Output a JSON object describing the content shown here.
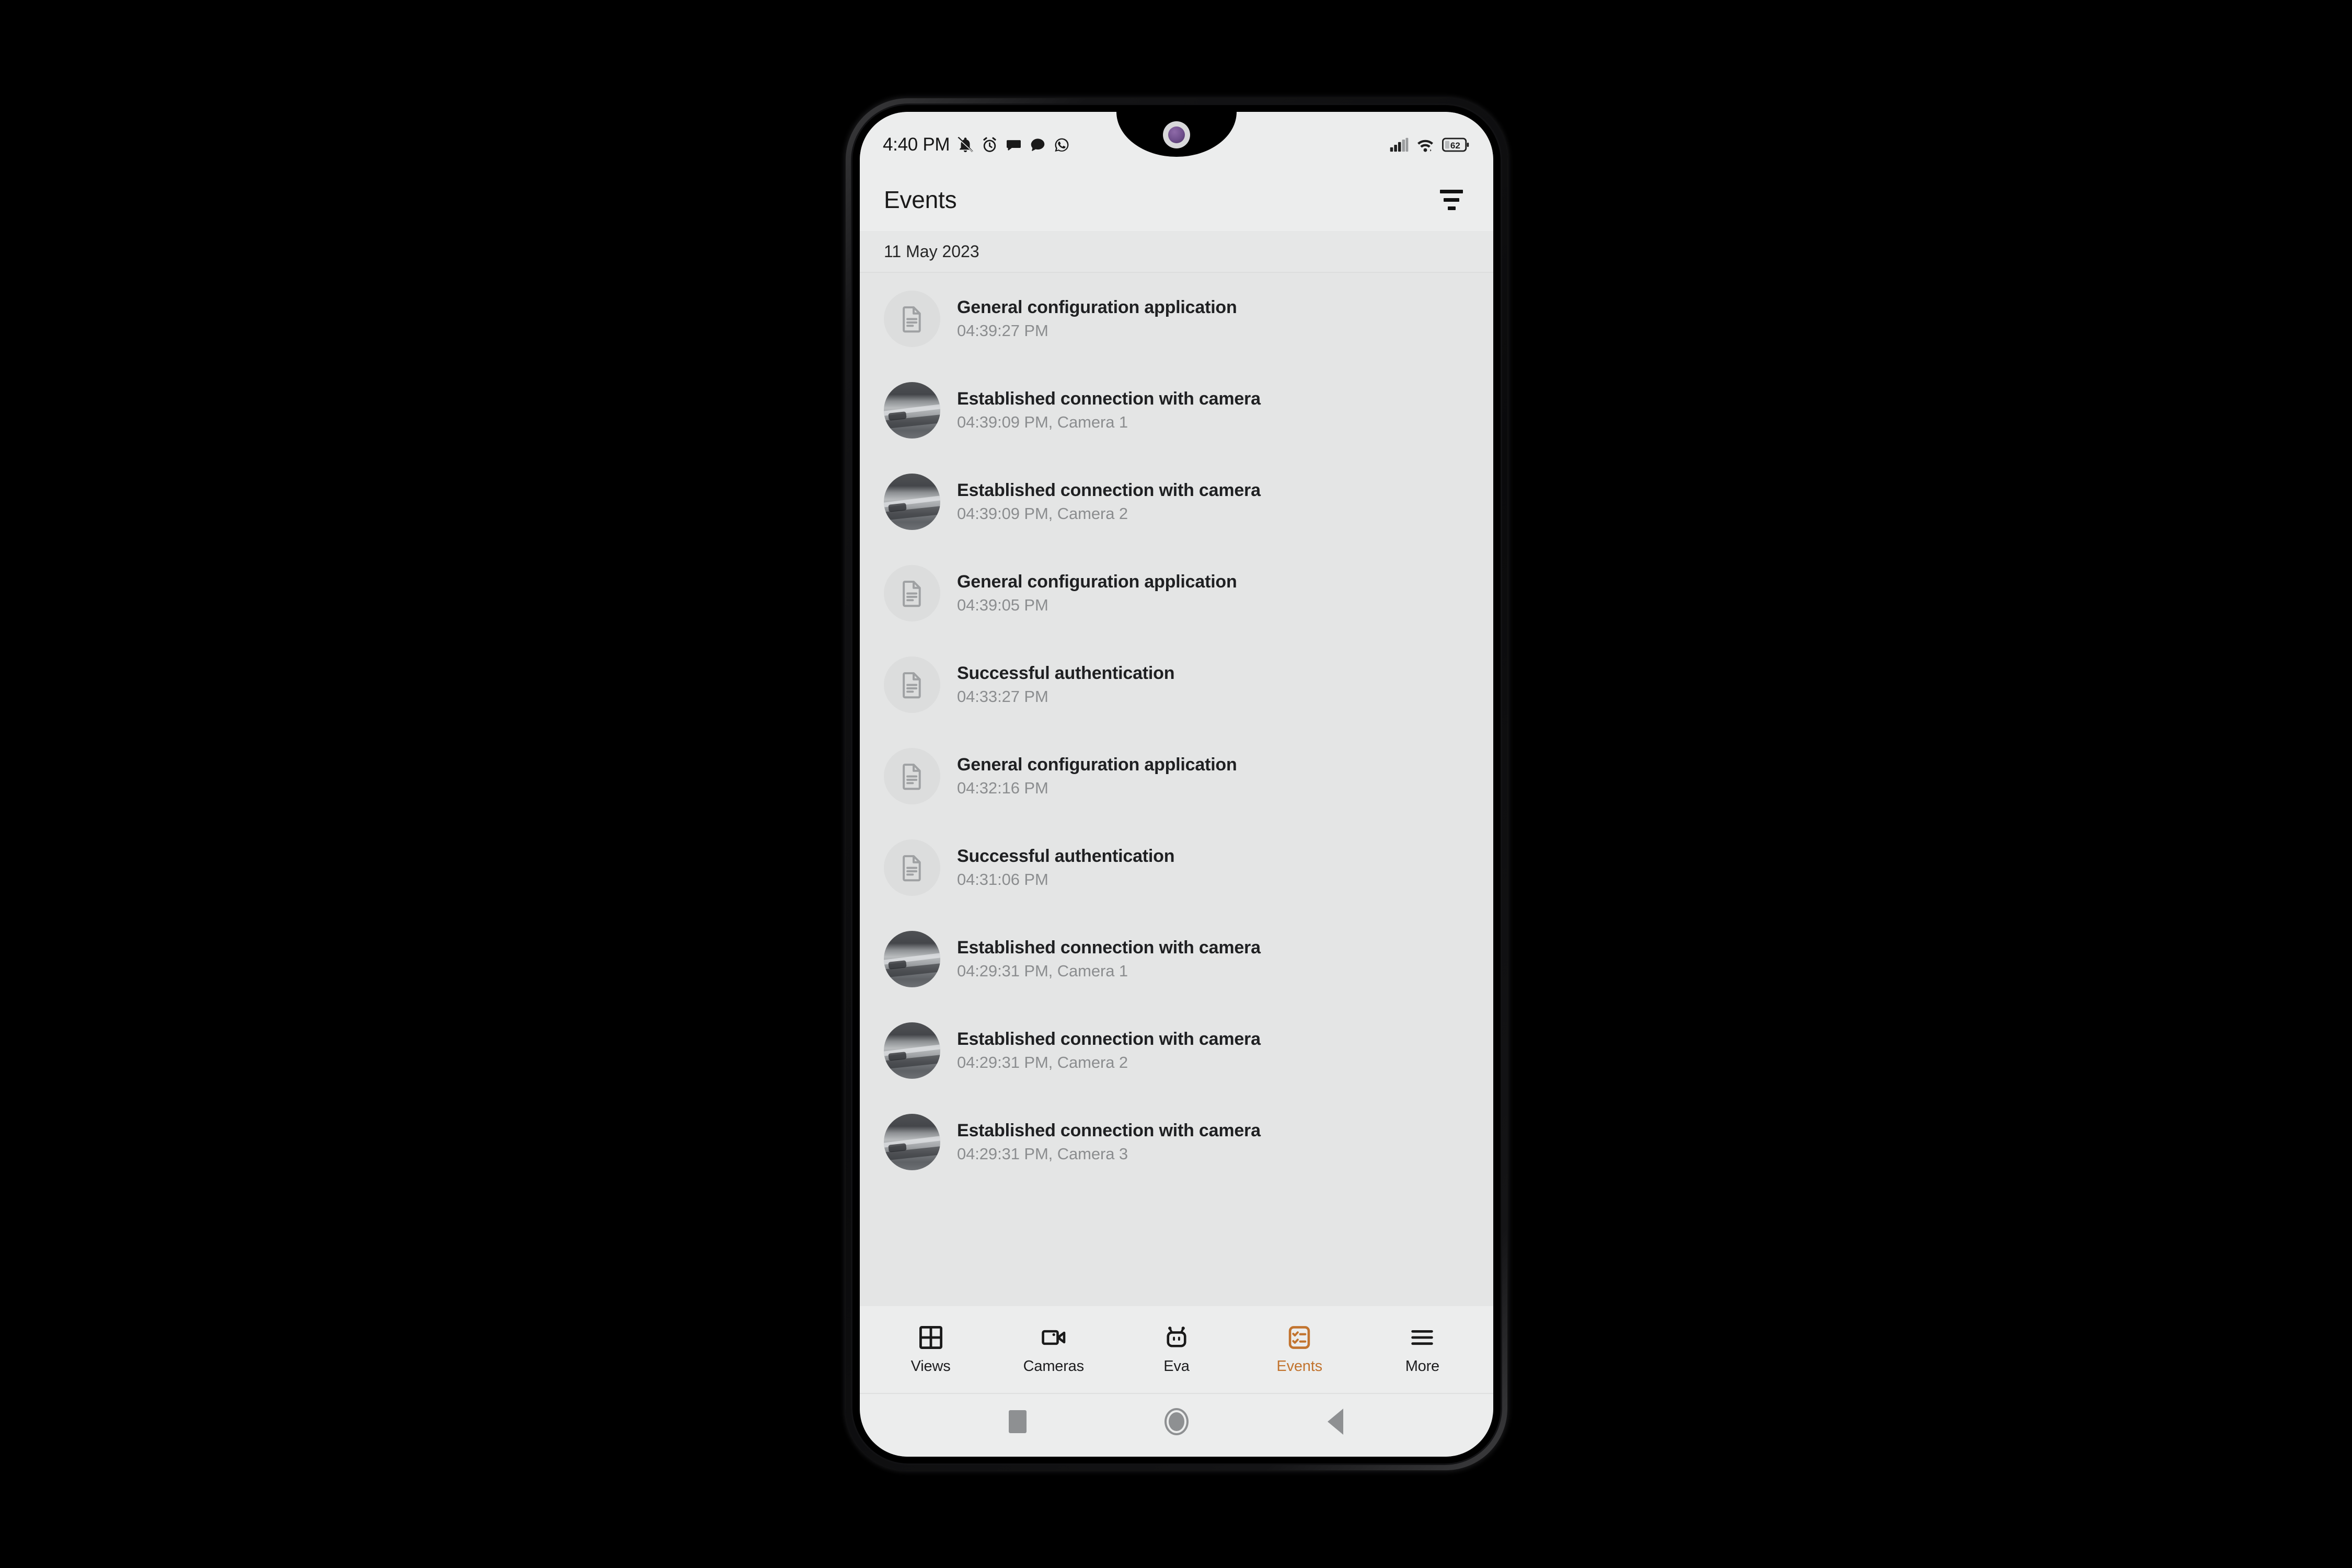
{
  "status_bar": {
    "clock": "4:40 PM",
    "battery_level": "62",
    "left_icons": [
      "bell-mute-icon",
      "alarm-clock-icon",
      "chat-bubble-icon",
      "message-icon",
      "whatsapp-icon"
    ],
    "right_icons": [
      "cellular-signal-icon",
      "wifi-icon",
      "battery-icon"
    ]
  },
  "app_bar": {
    "title": "Events",
    "filter_icon": "filter-icon"
  },
  "date_header": {
    "label": "11 May 2023"
  },
  "events": [
    {
      "title": "General configuration application",
      "subtitle": "04:39:27 PM",
      "avatar": "document-icon"
    },
    {
      "title": "Established connection with camera",
      "subtitle": "04:39:09 PM, Camera 1",
      "avatar": "camera-thumbnail"
    },
    {
      "title": "Established connection with camera",
      "subtitle": "04:39:09 PM, Camera 2",
      "avatar": "camera-thumbnail"
    },
    {
      "title": "General configuration application",
      "subtitle": "04:39:05 PM",
      "avatar": "document-icon"
    },
    {
      "title": "Successful authentication",
      "subtitle": "04:33:27 PM",
      "avatar": "document-icon"
    },
    {
      "title": "General configuration application",
      "subtitle": "04:32:16 PM",
      "avatar": "document-icon"
    },
    {
      "title": "Successful authentication",
      "subtitle": "04:31:06 PM",
      "avatar": "document-icon"
    },
    {
      "title": "Established connection with camera",
      "subtitle": "04:29:31 PM, Camera 1",
      "avatar": "camera-thumbnail"
    },
    {
      "title": "Established connection with camera",
      "subtitle": "04:29:31 PM, Camera 2",
      "avatar": "camera-thumbnail"
    },
    {
      "title": "Established connection with camera",
      "subtitle": "04:29:31 PM, Camera 3",
      "avatar": "camera-thumbnail"
    }
  ],
  "bottom_nav": {
    "active_color": "#c2742f",
    "items": [
      {
        "label": "Views",
        "icon": "grid-icon",
        "active": false
      },
      {
        "label": "Cameras",
        "icon": "video-camera-icon",
        "active": false
      },
      {
        "label": "Eva",
        "icon": "robot-icon",
        "active": false
      },
      {
        "label": "Events",
        "icon": "checklist-icon",
        "active": true
      },
      {
        "label": "More",
        "icon": "hamburger-icon",
        "active": false
      }
    ]
  },
  "system_nav": {
    "items": [
      {
        "label": "Recents",
        "icon": "square-icon"
      },
      {
        "label": "Home",
        "icon": "circle-icon"
      },
      {
        "label": "Back",
        "icon": "triangle-back-icon"
      }
    ]
  }
}
